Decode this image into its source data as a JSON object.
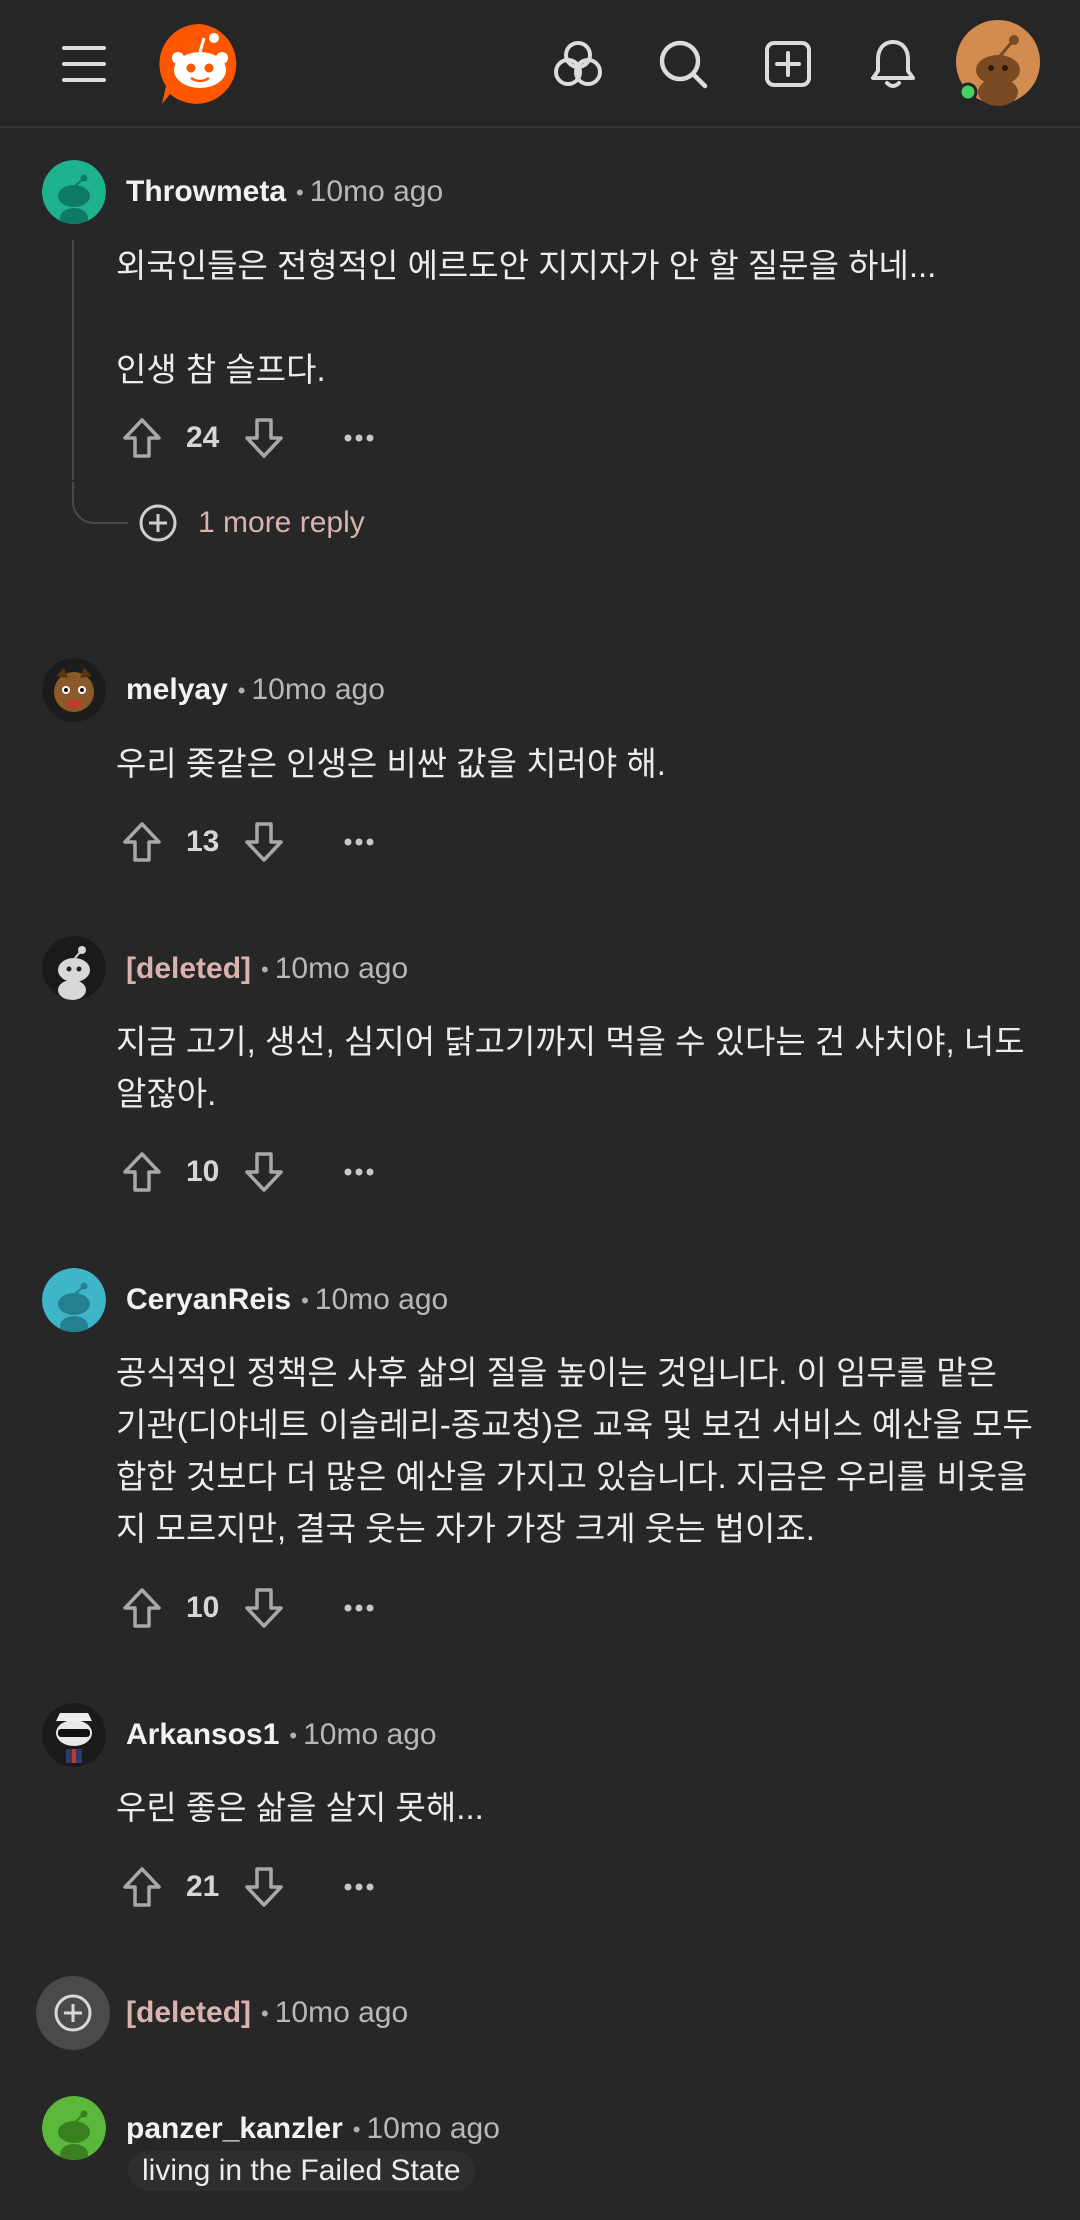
{
  "app": {
    "name": "Reddit"
  },
  "topbar": {
    "menu_icon": "hamburger-menu-icon",
    "logo_icon": "reddit-logo-icon",
    "explore_icon": "explore-icon",
    "search_icon": "search-icon",
    "create_icon": "create-post-icon",
    "notifications_icon": "bell-icon",
    "profile_online": true
  },
  "comments": [
    {
      "author": "Throwmeta",
      "time": "10mo ago",
      "avatar_color": "#1fb28f",
      "body": "외국인들은 전형적인 에르도안 지지자가 안 할 질문을 하네...\n\n인생 참 슬프다.",
      "score": "24",
      "more_replies": "1 more reply"
    },
    {
      "author": "melyay",
      "time": "10mo ago",
      "avatar_color": "#6b4226",
      "body": "우리 좆같은 인생은 비싼 값을 치러야 해.",
      "score": "13"
    },
    {
      "author": "[deleted]",
      "time": "10mo ago",
      "avatar_color": "#1a1a1a",
      "body": "지금 고기, 생선, 심지어 닭고기까지 먹을 수 있다는 건 사치야, 너도 알잖아.",
      "score": "10"
    },
    {
      "author": "CeryanReis",
      "time": "10mo ago",
      "avatar_color": "#3fb5c9",
      "body": "공식적인 정책은 사후 삶의 질을 높이는 것입니다. 이 임무를 맡은 기관(디야네트 이슬레리-종교청)은 교육 및 보건 서비스 예산을 모두 합한 것보다 더 많은 예산을 가지고 있습니다. 지금은 우리를 비웃을지 모르지만, 결국 웃는 자가 가장 크게 웃는 법이죠.",
      "score": "10"
    },
    {
      "author": "Arkansos1",
      "time": "10mo ago",
      "avatar_color": "#1a1a1a",
      "body": "우린 좋은 삶을 살지 못해...",
      "score": "21"
    },
    {
      "author": "[deleted]",
      "time": "10mo ago",
      "collapsed": true
    },
    {
      "author": "panzer_kanzler",
      "time": "10mo ago",
      "avatar_color": "#5cb83a",
      "flair": "living in the Failed State"
    }
  ],
  "colors": {
    "background": "#272727",
    "deleted_author": "#d9b3ad",
    "more_reply": "#d9b3ad",
    "online": "#46d160"
  }
}
